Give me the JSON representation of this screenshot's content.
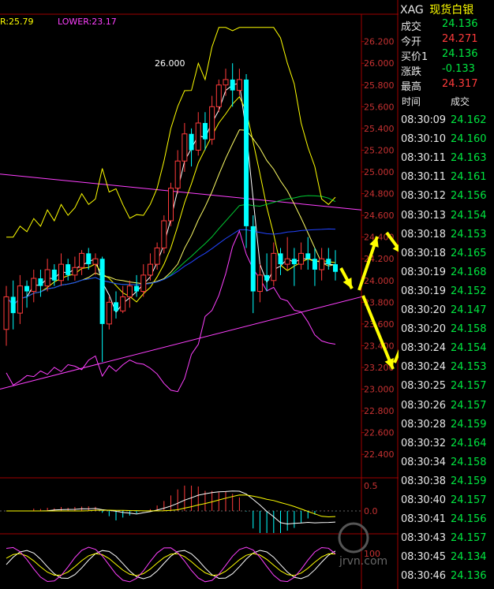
{
  "indicator": {
    "upper_label": "R:25.79",
    "lower_label": "LOWER:23.17",
    "upper_color": "#ffff00",
    "lower_color": "#ff40ff"
  },
  "quote": {
    "symbol": "XAG",
    "name": "现货白银",
    "rows": [
      {
        "label": "成交",
        "value": "24.136",
        "color": "#00e640"
      },
      {
        "label": "今开",
        "value": "24.271",
        "color": "#ff3b3b"
      },
      {
        "label": "买价1",
        "value": "24.136",
        "color": "#00e640"
      },
      {
        "label": "涨跌",
        "value": "-0.133",
        "color": "#00e640"
      },
      {
        "label": "最高",
        "value": "24.317",
        "color": "#ff3b3b"
      }
    ],
    "ticks_header": {
      "time": "时间",
      "price": "成交"
    },
    "ticks": [
      {
        "time": "08:30:09",
        "price": "24.162"
      },
      {
        "time": "08:30:10",
        "price": "24.160"
      },
      {
        "time": "08:30:11",
        "price": "24.163"
      },
      {
        "time": "08:30:11",
        "price": "24.161"
      },
      {
        "time": "08:30:12",
        "price": "24.156"
      },
      {
        "time": "08:30:13",
        "price": "24.154"
      },
      {
        "time": "08:30:18",
        "price": "24.153"
      },
      {
        "time": "08:30:18",
        "price": "24.165"
      },
      {
        "time": "08:30:19",
        "price": "24.168"
      },
      {
        "time": "08:30:19",
        "price": "24.152"
      },
      {
        "time": "08:30:20",
        "price": "24.147"
      },
      {
        "time": "08:30:20",
        "price": "24.158"
      },
      {
        "time": "08:30:24",
        "price": "24.154"
      },
      {
        "time": "08:30:24",
        "price": "24.153"
      },
      {
        "time": "08:30:25",
        "price": "24.157"
      },
      {
        "time": "08:30:26",
        "price": "24.157"
      },
      {
        "time": "08:30:28",
        "price": "24.159"
      },
      {
        "time": "08:30:32",
        "price": "24.164"
      },
      {
        "time": "08:30:34",
        "price": "24.158"
      },
      {
        "time": "08:30:38",
        "price": "24.159"
      },
      {
        "time": "08:30:40",
        "price": "24.157"
      },
      {
        "time": "08:30:41",
        "price": "24.156"
      },
      {
        "time": "08:30:43",
        "price": "24.157"
      },
      {
        "time": "08:30:45",
        "price": "24.134"
      },
      {
        "time": "08:30:46",
        "price": "24.136"
      }
    ]
  },
  "watermark": "jrvn.com",
  "chart_data": {
    "type": "candlestick",
    "price_axis": {
      "ylim": [
        22.3,
        26.35
      ],
      "ticks": [
        "22.400",
        "22.600",
        "22.800",
        "23.000",
        "23.200",
        "23.400",
        "23.600",
        "23.800",
        "24.000",
        "24.200",
        "24.400",
        "24.600",
        "24.800",
        "25.000",
        "25.200",
        "25.400",
        "25.600",
        "25.800",
        "26.000",
        "26.200"
      ]
    },
    "annotation": "26.000",
    "candles": [
      {
        "o": 23.55,
        "c": 23.85,
        "h": 23.95,
        "l": 23.4
      },
      {
        "o": 23.85,
        "c": 23.7,
        "h": 24.0,
        "l": 23.55
      },
      {
        "o": 23.7,
        "c": 23.95,
        "h": 24.05,
        "l": 23.6
      },
      {
        "o": 23.95,
        "c": 23.9,
        "h": 24.0,
        "l": 23.75
      },
      {
        "o": 23.9,
        "c": 24.02,
        "h": 24.1,
        "l": 23.8
      },
      {
        "o": 24.02,
        "c": 23.95,
        "h": 24.1,
        "l": 23.85
      },
      {
        "o": 23.95,
        "c": 24.1,
        "h": 24.2,
        "l": 23.9
      },
      {
        "o": 24.1,
        "c": 24.0,
        "h": 24.15,
        "l": 23.95
      },
      {
        "o": 24.0,
        "c": 24.15,
        "h": 24.25,
        "l": 23.95
      },
      {
        "o": 24.15,
        "c": 24.05,
        "h": 24.2,
        "l": 24.0
      },
      {
        "o": 24.05,
        "c": 24.12,
        "h": 24.22,
        "l": 24.0
      },
      {
        "o": 24.12,
        "c": 24.25,
        "h": 24.28,
        "l": 24.05
      },
      {
        "o": 24.25,
        "c": 24.15,
        "h": 24.3,
        "l": 24.1
      },
      {
        "o": 24.15,
        "c": 24.2,
        "h": 24.25,
        "l": 24.05
      },
      {
        "o": 24.2,
        "c": 23.6,
        "h": 24.22,
        "l": 23.25
      },
      {
        "o": 23.6,
        "c": 23.8,
        "h": 23.85,
        "l": 23.55
      },
      {
        "o": 23.8,
        "c": 23.72,
        "h": 23.9,
        "l": 23.65
      },
      {
        "o": 23.72,
        "c": 23.85,
        "h": 23.95,
        "l": 23.7
      },
      {
        "o": 23.85,
        "c": 23.95,
        "h": 24.0,
        "l": 23.75
      },
      {
        "o": 23.95,
        "c": 23.9,
        "h": 24.05,
        "l": 23.85
      },
      {
        "o": 23.9,
        "c": 24.05,
        "h": 24.15,
        "l": 23.85
      },
      {
        "o": 24.05,
        "c": 24.15,
        "h": 24.25,
        "l": 24.0
      },
      {
        "o": 24.15,
        "c": 24.3,
        "h": 24.35,
        "l": 24.1
      },
      {
        "o": 24.3,
        "c": 24.55,
        "h": 24.6,
        "l": 24.25
      },
      {
        "o": 24.55,
        "c": 24.85,
        "h": 24.9,
        "l": 24.5
      },
      {
        "o": 24.85,
        "c": 25.1,
        "h": 25.2,
        "l": 24.8
      },
      {
        "o": 25.1,
        "c": 25.35,
        "h": 25.45,
        "l": 25.0
      },
      {
        "o": 25.35,
        "c": 25.2,
        "h": 25.4,
        "l": 25.05
      },
      {
        "o": 25.2,
        "c": 25.45,
        "h": 25.55,
        "l": 25.15
      },
      {
        "o": 25.45,
        "c": 25.3,
        "h": 25.55,
        "l": 25.2
      },
      {
        "o": 25.3,
        "c": 25.6,
        "h": 25.7,
        "l": 25.25
      },
      {
        "o": 25.6,
        "c": 25.8,
        "h": 25.85,
        "l": 25.55
      },
      {
        "o": 25.8,
        "c": 25.85,
        "h": 25.95,
        "l": 25.7
      },
      {
        "o": 25.85,
        "c": 25.75,
        "h": 26.0,
        "l": 25.6
      },
      {
        "o": 25.75,
        "c": 25.85,
        "h": 25.95,
        "l": 25.7
      },
      {
        "o": 25.85,
        "c": 24.5,
        "h": 25.9,
        "l": 24.3
      },
      {
        "o": 24.5,
        "c": 23.9,
        "h": 24.6,
        "l": 23.7
      },
      {
        "o": 23.9,
        "c": 24.05,
        "h": 24.15,
        "l": 23.8
      },
      {
        "o": 24.05,
        "c": 24.0,
        "h": 24.25,
        "l": 23.9
      },
      {
        "o": 24.0,
        "c": 24.25,
        "h": 24.35,
        "l": 23.95
      },
      {
        "o": 24.25,
        "c": 24.15,
        "h": 24.3,
        "l": 24.05
      },
      {
        "o": 24.15,
        "c": 24.2,
        "h": 24.4,
        "l": 24.1
      },
      {
        "o": 24.2,
        "c": 24.15,
        "h": 24.3,
        "l": 23.95
      },
      {
        "o": 24.15,
        "c": 24.25,
        "h": 24.35,
        "l": 24.1
      },
      {
        "o": 24.25,
        "c": 24.2,
        "h": 24.4,
        "l": 24.1
      },
      {
        "o": 24.2,
        "c": 24.1,
        "h": 24.3,
        "l": 23.95
      },
      {
        "o": 24.1,
        "c": 24.2,
        "h": 24.3,
        "l": 24.0
      },
      {
        "o": 24.2,
        "c": 24.15,
        "h": 24.3,
        "l": 24.1
      },
      {
        "o": 24.15,
        "c": 24.08,
        "h": 24.28,
        "l": 24.0
      }
    ],
    "channel": {
      "upper": 25.79,
      "lower": 23.17
    },
    "macd_axis": [
      "0.5",
      "0.0"
    ],
    "kdj_axis": [
      "100"
    ]
  }
}
